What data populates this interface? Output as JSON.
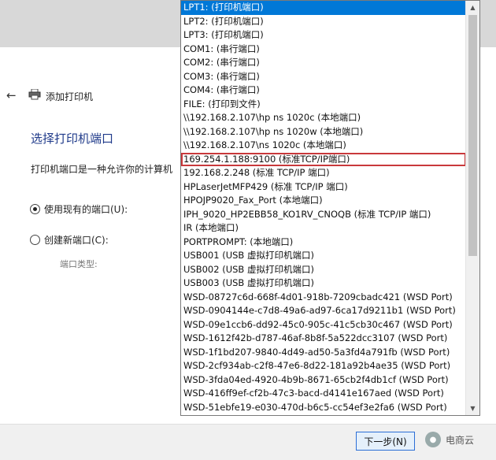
{
  "wizard": {
    "window_title": "添加打印机",
    "heading": "选择打印机端口",
    "description": "打印机端口是一种允许你的计算机",
    "radio_existing": "使用现有的端口(U):",
    "radio_new": "创建新端口(C):",
    "port_type_label": "端口类型:",
    "next_button": "下一步(N)",
    "watermark_text": "电商云"
  },
  "dropdown": {
    "items": [
      "LPT1: (打印机端口)",
      "LPT2: (打印机端口)",
      "LPT3: (打印机端口)",
      "COM1: (串行端口)",
      "COM2: (串行端口)",
      "COM3: (串行端口)",
      "COM4: (串行端口)",
      "FILE: (打印到文件)",
      "\\\\192.168.2.107\\hp ns 1020c (本地端口)",
      "\\\\192.168.2.107\\hp ns 1020w (本地端口)",
      "\\\\192.168.2.107\\ns 1020c (本地端口)",
      "169.254.1.188:9100  (标准TCP/IP端口)",
      "192.168.2.248 (标准 TCP/IP 端口)",
      "HPLaserJetMFP429 (标准 TCP/IP 端口)",
      "HPOJP9020_Fax_Port (本地端口)",
      "IPH_9020_HP2EBB58_KO1RV_CNOQB (标准 TCP/IP 端口)",
      "IR (本地端口)",
      "PORTPROMPT: (本地端口)",
      "USB001 (USB 虚拟打印机端口)",
      "USB002 (USB 虚拟打印机端口)",
      "USB003 (USB 虚拟打印机端口)",
      "WSD-08727c6d-668f-4d01-918b-7209cbadc421 (WSD Port)",
      "WSD-0904144e-c7d8-49a6-ad97-6ca17d9211b1 (WSD Port)",
      "WSD-09e1ccb6-dd92-45c0-905c-41c5cb30c467 (WSD Port)",
      "WSD-1612f42b-d787-46af-8b8f-5a522dcc3107 (WSD Port)",
      "WSD-1f1bd207-9840-4d49-ad50-5a3fd4a791fb (WSD Port)",
      "WSD-2cf934ab-c2f8-47e6-8d22-181a92b4ae35 (WSD Port)",
      "WSD-3fda04ed-4920-4b9b-8671-65cb2f4db1cf (WSD Port)",
      "WSD-416ff9ef-cf2b-47c3-bacd-d4141e167aed (WSD Port)",
      "WSD-51ebfe19-e030-470d-b6c5-cc54ef3e2fa6 (WSD Port)"
    ],
    "selected_index": 0,
    "highlighted_index": 11,
    "selected_color": "#0078d7",
    "highlight_color": "#c9393c"
  },
  "icons": {
    "back": "back-arrow-icon",
    "printer": "printer-icon",
    "scroll_up": "scroll-up-arrow-icon",
    "scroll_down": "scroll-down-arrow-icon"
  }
}
